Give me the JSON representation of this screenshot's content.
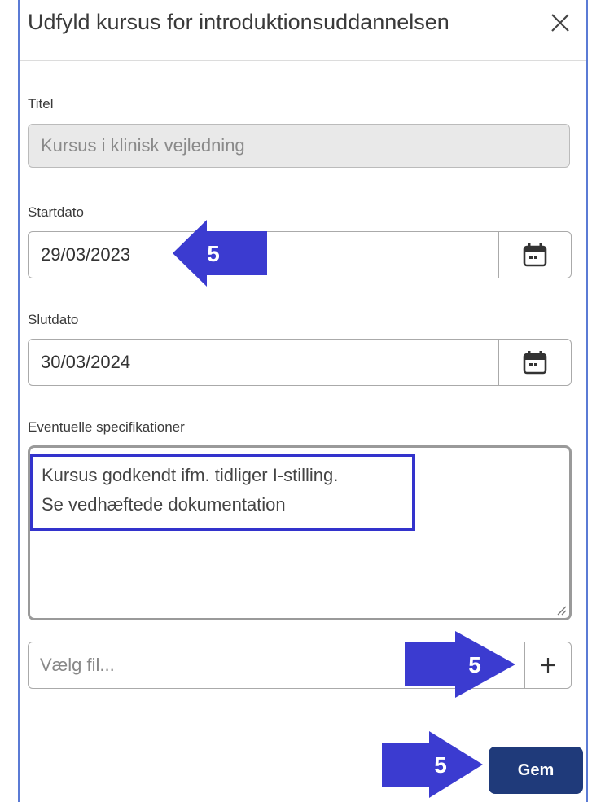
{
  "dialog": {
    "title": "Udfyld kursus for introduktionsuddannelsen",
    "close_icon": "close-icon"
  },
  "fields": {
    "title_label": "Titel",
    "title_value": "Kursus i klinisk vejledning",
    "start_label": "Startdato",
    "start_value": "29/03/2023",
    "end_label": "Slutdato",
    "end_value": "30/03/2024",
    "spec_label": "Eventuelle specifikationer",
    "spec_line1": "Kursus godkendt ifm. tidliger I-stilling.",
    "spec_line2": "Se vedhæftede dokumentation",
    "file_placeholder": "Vælg fil...",
    "add_file_label": "+"
  },
  "footer": {
    "save_label": "Gem"
  },
  "annotations": {
    "step_number": "5",
    "arrow_color": "#3b3bd0",
    "highlight_color": "#3333cc"
  },
  "colors": {
    "primary_button": "#1f3a7a",
    "modal_border": "#5b7bd5"
  }
}
